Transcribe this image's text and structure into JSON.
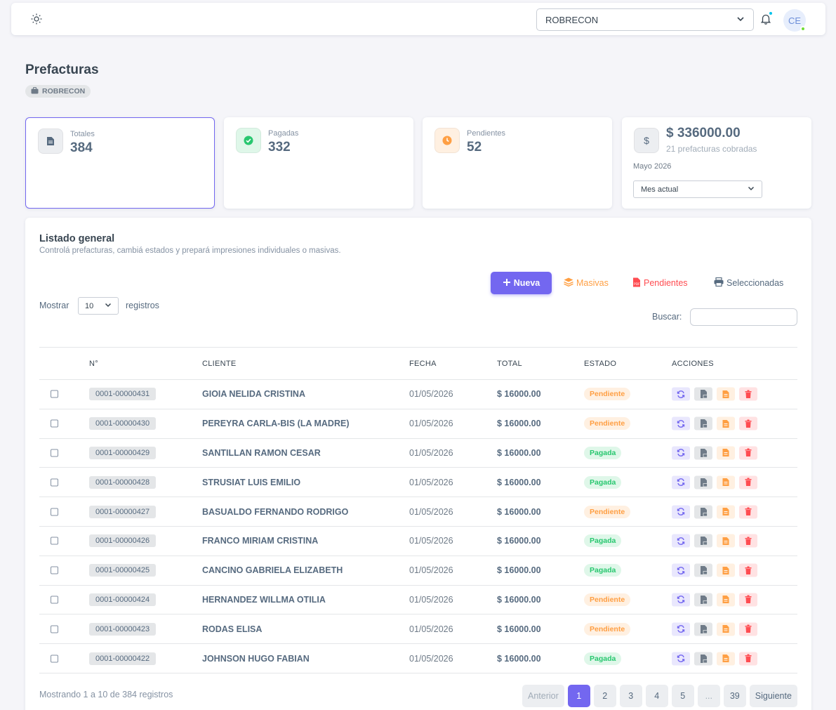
{
  "header": {
    "company": "ROBRECON",
    "user_initials": "CE"
  },
  "page": {
    "title": "Prefacturas",
    "company_badge": "ROBRECON"
  },
  "stats": {
    "totales": {
      "label": "Totales",
      "value": "384"
    },
    "pagadas": {
      "label": "Pagadas",
      "value": "332"
    },
    "pendientes": {
      "label": "Pendientes",
      "value": "52"
    },
    "money": {
      "value": "$ 336000.00",
      "subtitle": "21 prefacturas cobradas",
      "month": "Mayo 2026",
      "period": "Mes actual"
    }
  },
  "list": {
    "title": "Listado general",
    "subtitle": "Controlá prefacturas, cambiá estados y prepará impresiones individuales o masivas.",
    "buttons": {
      "nueva": "Nueva",
      "masivas": "Masivas",
      "pendientes": "Pendientes",
      "seleccionadas": "Seleccionadas"
    },
    "show_label": "Mostrar",
    "page_size": "10",
    "records_label": "registros",
    "search_label": "Buscar:",
    "columns": [
      "N°",
      "CLIENTE",
      "FECHA",
      "TOTAL",
      "ESTADO",
      "ACCIONES"
    ],
    "rows": [
      {
        "num": "0001-00000431",
        "cliente": "GIOIA NELIDA CRISTINA",
        "fecha": "01/05/2026",
        "total": "$ 16000.00",
        "estado": "Pendiente"
      },
      {
        "num": "0001-00000430",
        "cliente": "PEREYRA CARLA-BIS (LA MADRE)",
        "fecha": "01/05/2026",
        "total": "$ 16000.00",
        "estado": "Pendiente"
      },
      {
        "num": "0001-00000429",
        "cliente": "SANTILLAN RAMON CESAR",
        "fecha": "01/05/2026",
        "total": "$ 16000.00",
        "estado": "Pagada"
      },
      {
        "num": "0001-00000428",
        "cliente": "STRUSIAT LUIS EMILIO",
        "fecha": "01/05/2026",
        "total": "$ 16000.00",
        "estado": "Pagada"
      },
      {
        "num": "0001-00000427",
        "cliente": "BASUALDO FERNANDO RODRIGO",
        "fecha": "01/05/2026",
        "total": "$ 16000.00",
        "estado": "Pendiente"
      },
      {
        "num": "0001-00000426",
        "cliente": "FRANCO MIRIAM CRISTINA",
        "fecha": "01/05/2026",
        "total": "$ 16000.00",
        "estado": "Pagada"
      },
      {
        "num": "0001-00000425",
        "cliente": "CANCINO GABRIELA ELIZABETH",
        "fecha": "01/05/2026",
        "total": "$ 16000.00",
        "estado": "Pagada"
      },
      {
        "num": "0001-00000424",
        "cliente": "HERNANDEZ WILLMA OTILIA",
        "fecha": "01/05/2026",
        "total": "$ 16000.00",
        "estado": "Pendiente"
      },
      {
        "num": "0001-00000423",
        "cliente": "RODAS ELISA",
        "fecha": "01/05/2026",
        "total": "$ 16000.00",
        "estado": "Pendiente"
      },
      {
        "num": "0001-00000422",
        "cliente": "JOHNSON HUGO FABIAN",
        "fecha": "01/05/2026",
        "total": "$ 16000.00",
        "estado": "Pagada"
      }
    ],
    "info": "Mostrando 1 a 10 de 384 registros",
    "pagination": {
      "prev": "Anterior",
      "pages": [
        "1",
        "2",
        "3",
        "4",
        "5",
        "...",
        "39"
      ],
      "active": "1",
      "next": "Siguiente"
    }
  },
  "colors": {
    "primary": "#7367f0",
    "pending": "#ff9f43",
    "paid": "#28c76f",
    "danger": "#ff4c51"
  }
}
